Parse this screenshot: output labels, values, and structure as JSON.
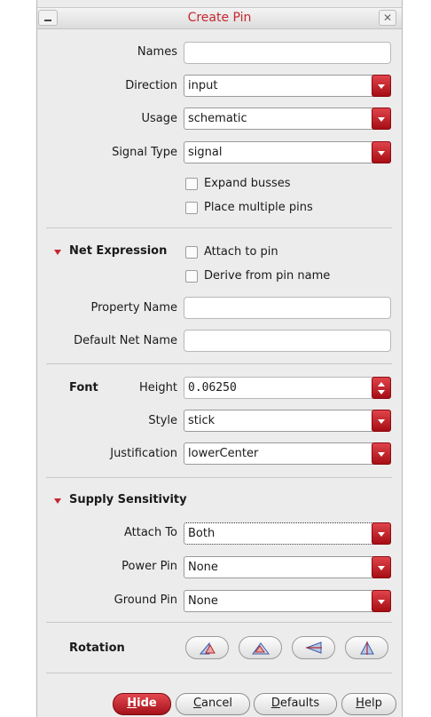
{
  "window": {
    "title": "Create Pin"
  },
  "pin": {
    "names_label": "Names",
    "names_value": "",
    "direction_label": "Direction",
    "direction_value": "input",
    "usage_label": "Usage",
    "usage_value": "schematic",
    "signal_type_label": "Signal Type",
    "signal_type_value": "signal",
    "expand_busses_label": "Expand busses",
    "place_multiple_label": "Place multiple pins"
  },
  "net_expression": {
    "title": "Net Expression",
    "attach_label": "Attach to pin",
    "derive_label": "Derive from pin name",
    "property_name_label": "Property Name",
    "property_name_value": "",
    "default_net_label": "Default Net Name",
    "default_net_value": ""
  },
  "font": {
    "title": "Font",
    "height_label": "Height",
    "height_value": "0.06250",
    "style_label": "Style",
    "style_value": "stick",
    "justification_label": "Justification",
    "justification_value": "lowerCenter"
  },
  "supply": {
    "title": "Supply Sensitivity",
    "attach_to_label": "Attach To",
    "attach_to_value": "Both",
    "power_pin_label": "Power Pin",
    "power_pin_value": "None",
    "ground_pin_label": "Ground Pin",
    "ground_pin_value": "None"
  },
  "rotation": {
    "title": "Rotation",
    "buttons": [
      "rotate-icon",
      "mirror-icon",
      "flip-horizontal-icon",
      "flip-vertical-icon"
    ]
  },
  "buttons": {
    "hide_accel": "H",
    "hide_rest": "ide",
    "cancel_accel": "C",
    "cancel_rest": "ancel",
    "defaults_accel": "D",
    "defaults_rest": "efaults",
    "help_accel": "H",
    "help_rest": "elp"
  },
  "colors": {
    "accent": "#c4272f",
    "dialog_bg": "#ececec"
  }
}
